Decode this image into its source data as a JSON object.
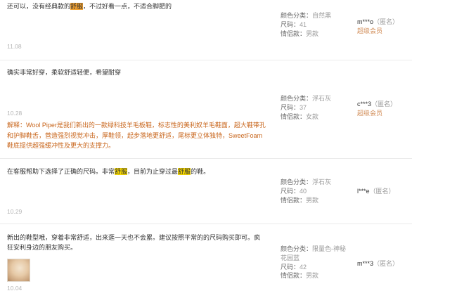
{
  "labels": {
    "color": "颜色分类：",
    "size": "尺码：",
    "couple": "情侣款：",
    "anonymous": "（匿名）",
    "explanation_prefix": "解释："
  },
  "reviews": [
    {
      "content_parts": [
        "还可以，没有经典款的",
        "舒服",
        "，不过好看一点，不适合脚肥的"
      ],
      "date": "11.08",
      "color": "自然黑",
      "size": "41",
      "couple": "男款",
      "user": "m***o",
      "vip": "超级会员"
    },
    {
      "content": "确实非常好穿，柔软舒适轻便，希望耐穿",
      "date": "10.28",
      "reply": "Wool Piper是我们新出的一款绿科技羊毛板鞋，标志性的美利奴羊毛鞋面，超大鞋带孔和护脚鞋舌，营造强烈视觉冲击，厚鞋领，起步落地更舒适，尾标更立体独特，SweetFoam鞋底提供超强缓冲性及更大的支撑力。",
      "color": "浮石灰",
      "size": "37",
      "couple": "女款",
      "user": "c***3",
      "vip": "超级会员"
    },
    {
      "content_parts": [
        "在客服帮助下选择了正确的尺码。非常",
        "舒服",
        "，目前为止穿过最",
        "舒服",
        "的鞋。"
      ],
      "date": "10.29",
      "color": "浮石灰",
      "size": "40",
      "couple": "男款",
      "user": "l***e"
    },
    {
      "content": "新出的鞋型哦，穿着非常舒适，出来逛一天也不会累。建议按照平常的的尺码购买即可。疯狂安利身边的朋友购买。",
      "date": "10.04",
      "color": "限量色-神秘花园蓝",
      "size": "42",
      "couple": "男款",
      "user": "m***3"
    }
  ]
}
